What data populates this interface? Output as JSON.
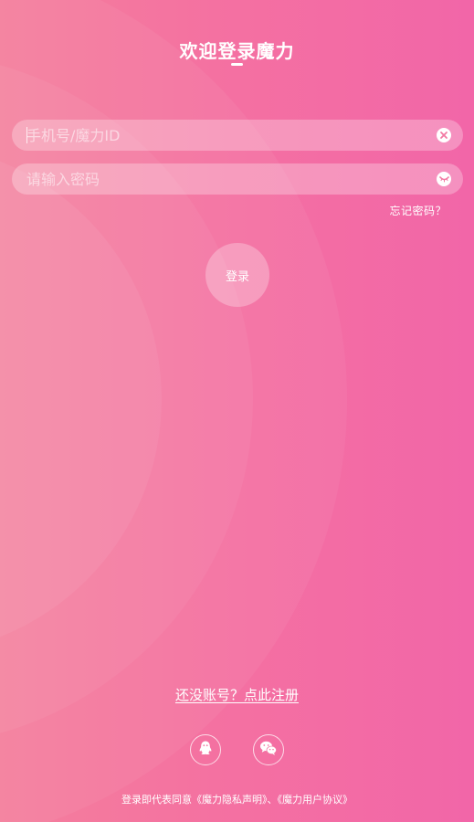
{
  "header": {
    "title": "欢迎登录魔力"
  },
  "form": {
    "phone_placeholder": "手机号/魔力ID",
    "phone_value": "",
    "password_placeholder": "请输入密码",
    "password_value": "",
    "forgot_label": "忘记密码？",
    "login_label": "登录"
  },
  "footer": {
    "register_label": "还没账号？点此注册",
    "terms_prefix": "登录即代表同意",
    "privacy_link": "《魔力隐私声明》",
    "separator": "、",
    "agreement_link": "《魔力用户协议》"
  },
  "icons": {
    "clear": "clear-icon",
    "eye": "eye-icon",
    "qq": "qq-icon",
    "wechat": "wechat-icon"
  },
  "colors": {
    "background_start": "#f47f9c",
    "background_end": "#f266a8",
    "text": "#ffffff"
  }
}
